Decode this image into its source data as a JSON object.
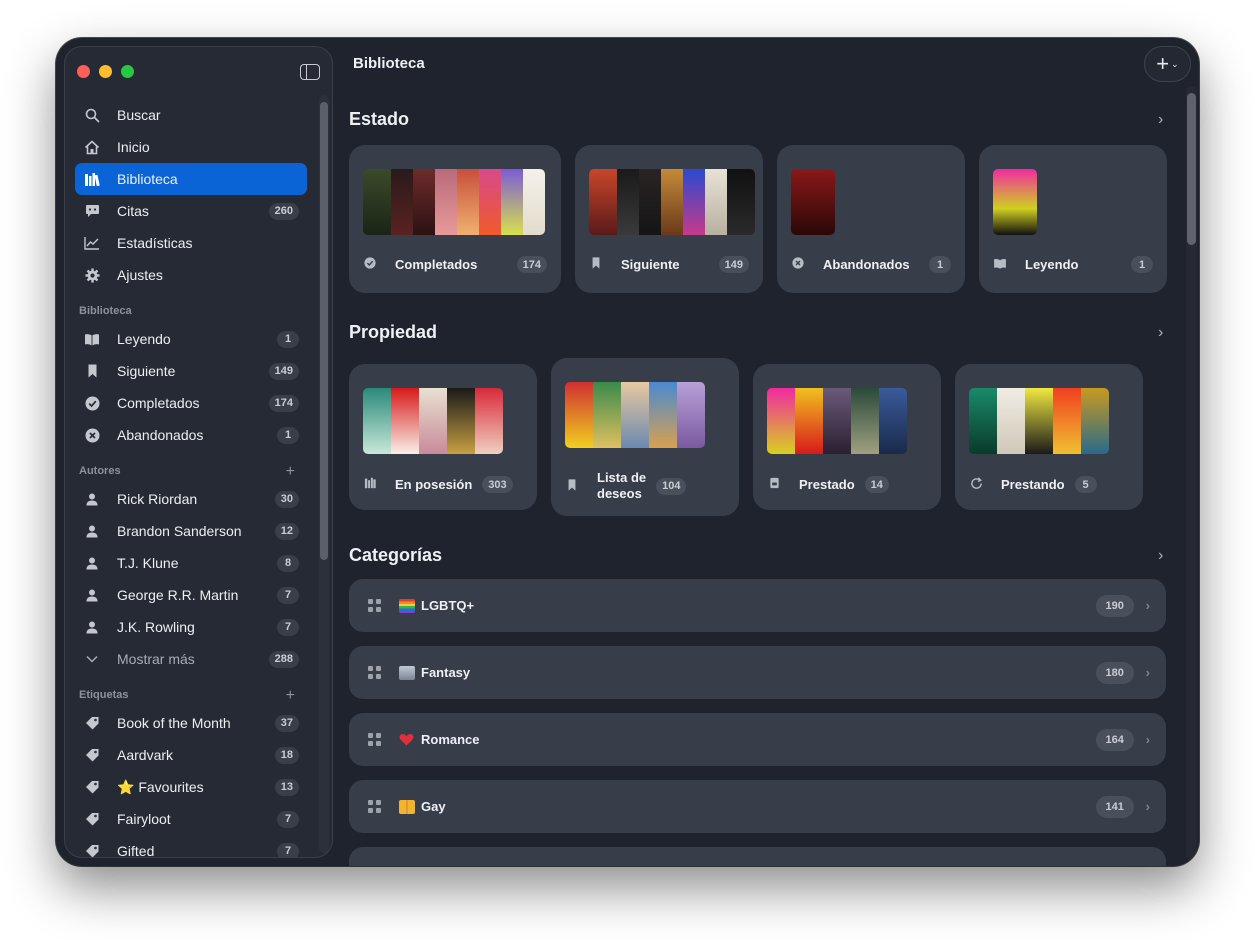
{
  "window": {
    "title": "Biblioteca"
  },
  "sidebar": {
    "nav": [
      {
        "label": "Buscar",
        "icon": "magnifier-icon"
      },
      {
        "label": "Inicio",
        "icon": "home-icon"
      },
      {
        "label": "Biblioteca",
        "icon": "library-icon",
        "active": true
      },
      {
        "label": "Citas",
        "icon": "quote-bubble-icon",
        "count": "260"
      },
      {
        "label": "Estadísticas",
        "icon": "chart-line-icon"
      },
      {
        "label": "Ajustes",
        "icon": "gear-icon"
      }
    ],
    "library_header": "Biblioteca",
    "library": [
      {
        "label": "Leyendo",
        "icon": "open-book-icon",
        "count": "1"
      },
      {
        "label": "Siguiente",
        "icon": "bookmark-icon",
        "count": "149"
      },
      {
        "label": "Completados",
        "icon": "checkmark-circle-icon",
        "count": "174"
      },
      {
        "label": "Abandonados",
        "icon": "x-circle-icon",
        "count": "1"
      }
    ],
    "authors_header": "Autores",
    "authors": [
      {
        "label": "Rick Riordan",
        "count": "30"
      },
      {
        "label": "Brandon Sanderson",
        "count": "12"
      },
      {
        "label": "T.J. Klune",
        "count": "8"
      },
      {
        "label": "George R.R. Martin",
        "count": "7"
      },
      {
        "label": "J.K. Rowling",
        "count": "7"
      }
    ],
    "show_more": {
      "label": "Mostrar más",
      "count": "288"
    },
    "tags_header": "Etiquetas",
    "tags": [
      {
        "label": "Book of the Month",
        "count": "37"
      },
      {
        "label": "Aardvark",
        "count": "18"
      },
      {
        "label": "⭐ Favourites",
        "count": "13"
      },
      {
        "label": "Fairyloot",
        "count": "7"
      },
      {
        "label": "Gifted",
        "count": "7"
      }
    ]
  },
  "main": {
    "estado": {
      "title": "Estado",
      "cards": [
        {
          "label": "Completados",
          "count": "174",
          "icon": "checkmark-circle-icon"
        },
        {
          "label": "Siguiente",
          "count": "149",
          "icon": "bookmark-icon"
        },
        {
          "label": "Abandonados",
          "count": "1",
          "icon": "x-circle-icon"
        },
        {
          "label": "Leyendo",
          "count": "1",
          "icon": "open-book-icon"
        }
      ]
    },
    "propiedad": {
      "title": "Propiedad",
      "cards": [
        {
          "label": "En posesión",
          "count": "303",
          "icon": "library-icon"
        },
        {
          "label": "Lista de deseos",
          "label_line1": "Lista de",
          "label_line2": "deseos",
          "count": "104",
          "icon": "bookmark-icon"
        },
        {
          "label": "Prestado",
          "count": "14",
          "icon": "borrowed-book-icon"
        },
        {
          "label": "Prestando",
          "count": "5",
          "icon": "sync-arrows-icon"
        }
      ]
    },
    "categorias": {
      "title": "Categorías",
      "rows": [
        {
          "label": "🏳️‍🌈 LGBTQ+",
          "text": "LGBTQ+",
          "count": "190",
          "emoji_color": "#e8a33c"
        },
        {
          "label": "🏰 Fantasy",
          "text": "Fantasy",
          "count": "180",
          "emoji_color": "#a9b2c2"
        },
        {
          "label": "❤️ Romance",
          "text": "Romance",
          "count": "164",
          "emoji_color": "#e0303a"
        },
        {
          "label": "👬 Gay",
          "text": "Gay",
          "count": "141",
          "emoji_color": "#f0b530"
        }
      ]
    }
  },
  "colors": {
    "accent": "#0a64d6",
    "background": "#1f232d",
    "card": "#383d4a"
  }
}
